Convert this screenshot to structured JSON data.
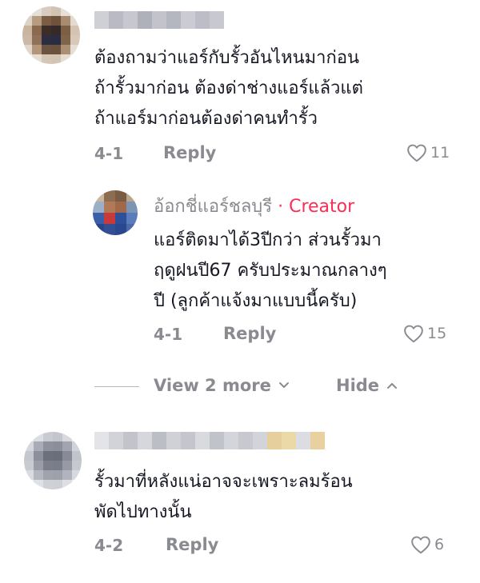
{
  "comments": [
    {
      "text_lines": [
        "ต้องถามว่าแอร์กับรั้วอันไหนมาก่อน",
        "ถ้ารั้วมาก่อน ต้องด่าช่างแอร์แล้วแต่",
        "ถ้าแอร์มาก่อนต้องด่าคนทำรั้ว"
      ],
      "date": "4-1",
      "reply_label": "Reply",
      "likes": "11"
    },
    {
      "author": "อ้อกชี่แอร์ชลบุรี",
      "badge": "· Creator",
      "text_lines": [
        "แอร์ติดมาได้3ปีกว่า ส่วนรั้วมา",
        "ฤดูฝนปี67 ครับประมาณกลางๆ",
        "ปี (ลูกค้าแจ้งมาแบบนี้ครับ)"
      ],
      "date": "4-1",
      "reply_label": "Reply",
      "likes": "15"
    },
    {
      "text_lines": [
        "รั้วมาที่หลังแน่อาจจะเพราะลมร้อน",
        "พัดไปทางนั้น"
      ],
      "date": "4-2",
      "reply_label": "Reply",
      "likes": "6"
    }
  ],
  "thread": {
    "view_more": "View 2 more",
    "hide": "Hide"
  },
  "colors": {
    "creator_badge": "#fe2c55",
    "text": "#161823",
    "muted": "#8a8b91"
  },
  "icons": [
    "heart-icon",
    "chevron-down-icon",
    "chevron-up-icon"
  ]
}
